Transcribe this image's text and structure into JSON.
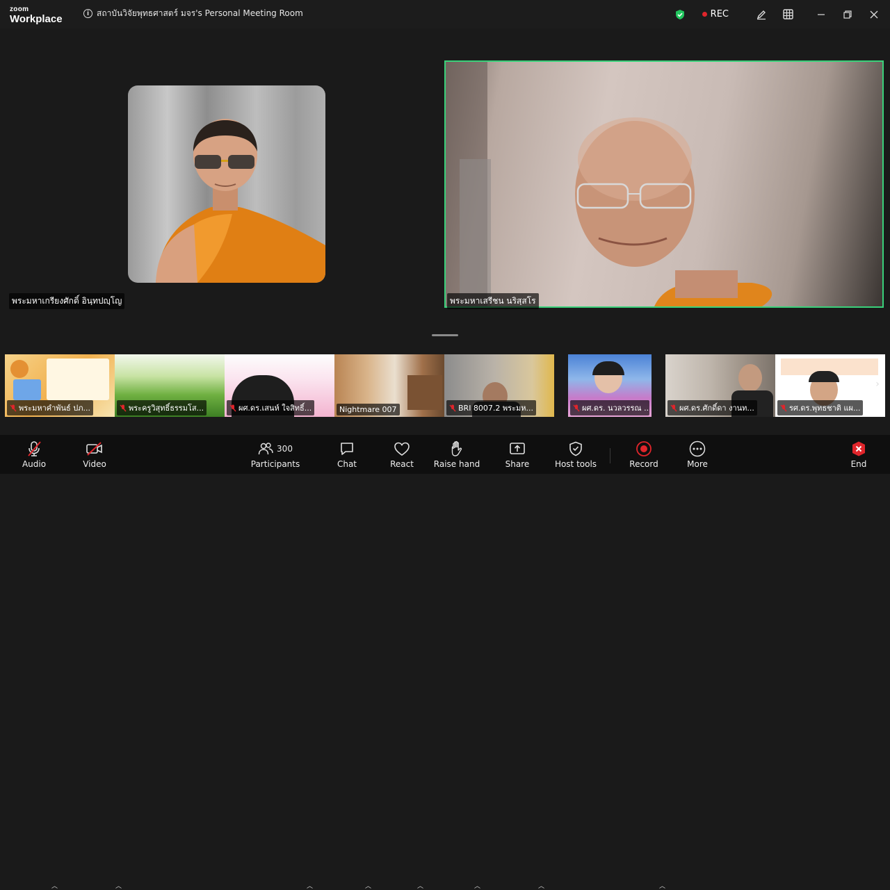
{
  "window": {
    "brand_top": "zoom",
    "brand_bottom": "Workplace",
    "meeting_title": "สถาบันวิจัยพุทธศาสตร์ มจร's Personal Meeting Room",
    "rec_label": "REC"
  },
  "main_videos": [
    {
      "name": "พระมหาเกรียงศักดิ์ อินฺทปญฺโญ"
    },
    {
      "name": "พระมหาเสรีชน นริสฺสโร"
    }
  ],
  "thumbnails": [
    {
      "name": "พระมหาคำพันธ์ ปภ..."
    },
    {
      "name": "พระครูวิสุทธิ์ธรรมโส..."
    },
    {
      "name": "ผศ.ดร.เสนห์ ใจสิทธิ์..."
    },
    {
      "name": "Nightmare 007"
    },
    {
      "name": "BRI 8007.2 พระมห..."
    },
    {
      "name": "ผศ.ดร. นวลวรรณ ..."
    },
    {
      "name": "ผศ.ดร.ศักดิ์ดา งานท..."
    },
    {
      "name": "รศ.ดร.พุทธชาติ แผ..."
    }
  ],
  "toolbar": {
    "audio": "Audio",
    "video": "Video",
    "participants": "Participants",
    "participants_count": "300",
    "chat": "Chat",
    "react": "React",
    "raise_hand": "Raise hand",
    "share": "Share",
    "host_tools": "Host tools",
    "record": "Record",
    "more": "More",
    "end": "End"
  },
  "colors": {
    "active_speaker": "#39d17a",
    "rec_red": "#e0252b",
    "muted_red": "#e0252b",
    "shield_green": "#22c55e"
  }
}
